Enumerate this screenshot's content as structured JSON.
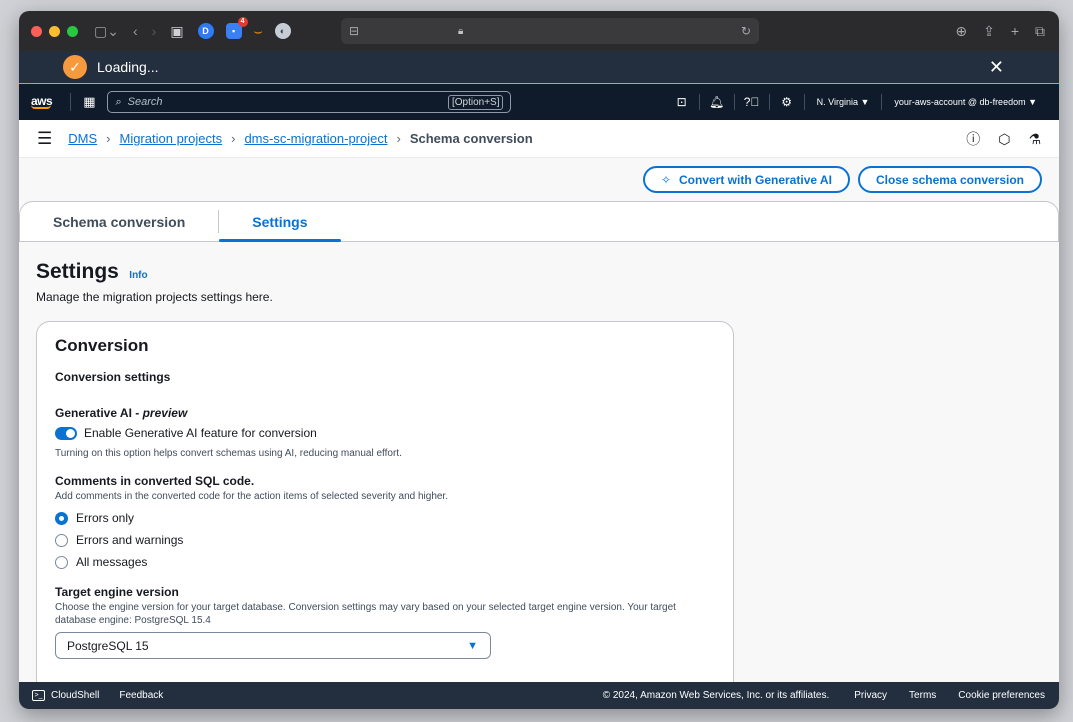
{
  "browser": {
    "tab_badge": "4",
    "ext_d": "D"
  },
  "loading": {
    "text": "Loading...",
    "close": "✕"
  },
  "aws_nav": {
    "logo": "aws",
    "search_placeholder": "Search",
    "search_shortcut": "[Option+S]",
    "region": "N. Virginia ▼",
    "account": "your-aws-account @ db-freedom ▼"
  },
  "breadcrumb": {
    "items": [
      "DMS",
      "Migration projects",
      "dms-sc-migration-project"
    ],
    "current": "Schema conversion"
  },
  "actions": {
    "convert_ai": "Convert with Generative AI",
    "close_conversion": "Close schema conversion"
  },
  "tabs": [
    {
      "label": "Schema conversion",
      "active": false
    },
    {
      "label": "Settings",
      "active": true
    }
  ],
  "page": {
    "title": "Settings",
    "info": "Info",
    "description": "Manage the migration projects settings here."
  },
  "conversion": {
    "title": "Conversion",
    "subtitle": "Conversion settings",
    "genai": {
      "label_prefix": "Generative AI - ",
      "label_preview": "preview",
      "toggle_label": "Enable Generative AI feature for conversion",
      "toggle_on": true,
      "hint": "Turning on this option helps convert schemas using AI, reducing manual effort."
    },
    "comments": {
      "label": "Comments in converted SQL code.",
      "hint": "Add comments in the converted code for the action items of selected severity and higher.",
      "options": [
        "Errors only",
        "Errors and warnings",
        "All messages"
      ],
      "selected": 0
    },
    "engine": {
      "label": "Target engine version",
      "hint": "Choose the engine version for your target database. Conversion settings may vary based on your selected target engine version. Your target database engine: PostgreSQL 15.4",
      "selected": "PostgreSQL 15"
    }
  },
  "footer": {
    "cloudshell": "CloudShell",
    "feedback": "Feedback",
    "copyright": "© 2024, Amazon Web Services, Inc. or its affiliates.",
    "privacy": "Privacy",
    "terms": "Terms",
    "cookies": "Cookie preferences"
  },
  "colors": {
    "accent": "#0972d3",
    "aws_orange": "#ff9900",
    "nav_bg": "#0f1b2a",
    "footer_bg": "#232f3e"
  }
}
